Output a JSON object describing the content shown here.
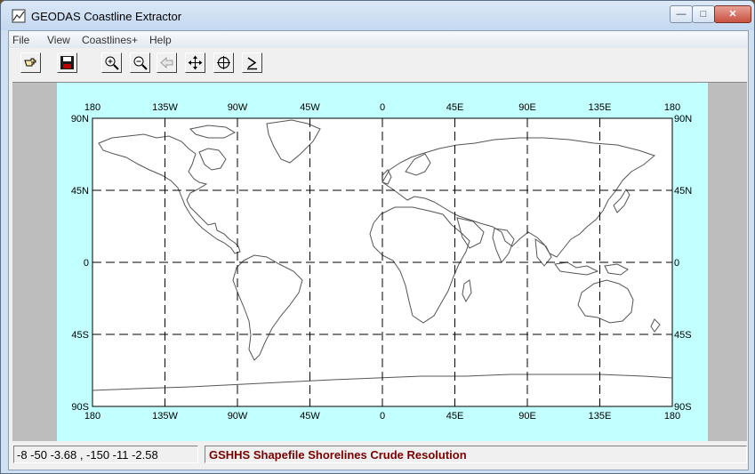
{
  "window": {
    "title": "GEODAS Coastline Extractor",
    "minimize_glyph": "—",
    "maximize_glyph": "□",
    "close_glyph": "✕"
  },
  "menu": [
    "File",
    "View",
    "Coastlines+",
    "Help"
  ],
  "toolbar": {
    "buttons": [
      {
        "name": "hand-pointer-icon"
      },
      {
        "name": "save-disk-icon"
      },
      {
        "name": "zoom-in-icon"
      },
      {
        "name": "zoom-out-icon"
      },
      {
        "name": "back-arrow-icon",
        "disabled": true
      },
      {
        "name": "pan-move-icon"
      },
      {
        "name": "crosshair-icon"
      },
      {
        "name": "summation-icon"
      }
    ]
  },
  "map": {
    "background_color": "#c2ffff",
    "grid_style": "dashed",
    "longitude_labels": [
      "180",
      "135W",
      "90W",
      "45W",
      "0",
      "45E",
      "90E",
      "135E",
      "180"
    ],
    "latitude_labels": [
      "90N",
      "45N",
      "0",
      "45S",
      "90S"
    ]
  },
  "status": {
    "coordinates": "-8 -50 -3.68 , -150 -11 -2.58",
    "layer_text": "GSHHS Shapefile Shorelines  Crude Resolution",
    "layer_text_color": "#7a0000"
  }
}
